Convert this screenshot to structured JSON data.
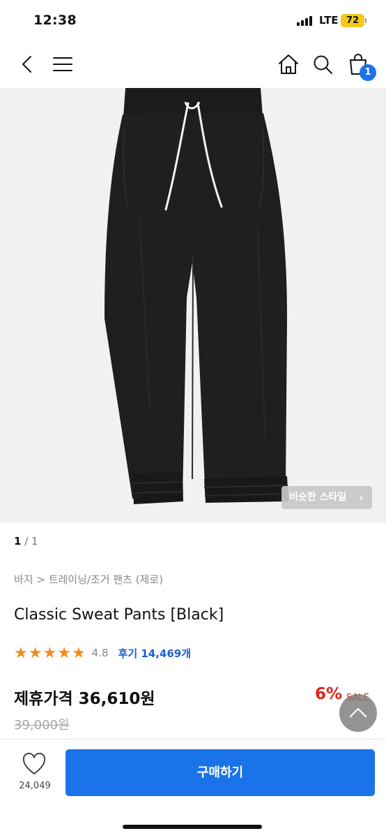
{
  "status_bar": {
    "time": "12:38",
    "network": "LTE",
    "battery": "72"
  },
  "nav": {
    "back_icon": "chevron-left-icon",
    "menu_icon": "hamburger-icon",
    "home_icon": "home-icon",
    "search_icon": "search-icon",
    "cart_icon": "shopping-bag-icon",
    "cart_count": "1"
  },
  "gallery": {
    "similar_style_label": "비슷한 스타일",
    "current_page": "1",
    "total_pages": "/ 1"
  },
  "product": {
    "breadcrumb": "바지 > 트레이닝/조거 팬츠 (제로)",
    "title": "Classic Sweat Pants [Black]",
    "rating": "4.8",
    "rating_stars": 4.8,
    "reviews": "후기 14,469개",
    "price_label": "제휴가격 36,610원",
    "discount": "6%",
    "sale_tag": "SALE",
    "original_price": "39,000원"
  },
  "bottom_bar": {
    "wish_count": "24,049",
    "buy_label": "구매하기"
  },
  "colors": {
    "accent": "#1a73e8",
    "sale": "#e0231b",
    "star": "#f28b1e"
  }
}
